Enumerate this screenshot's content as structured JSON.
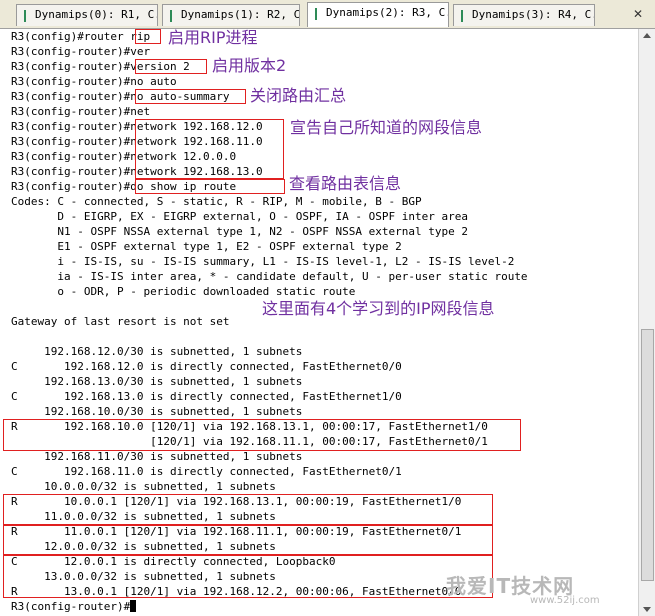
{
  "tabs": [
    {
      "label": "Dynamips(0): R1, C..."
    },
    {
      "label": "Dynamips(1): R2, C..."
    },
    {
      "label": "Dynamips(2): R3, C..."
    },
    {
      "label": "Dynamips(3): R4, C..."
    }
  ],
  "close_glyph": "✕",
  "terminal_lines": [
    "R3(config)#router rip",
    "R3(config-router)#ver",
    "R3(config-router)#version 2",
    "R3(config-router)#no auto",
    "R3(config-router)#no auto-summary",
    "R3(config-router)#net",
    "R3(config-router)#network 192.168.12.0",
    "R3(config-router)#network 192.168.11.0",
    "R3(config-router)#network 12.0.0.0",
    "R3(config-router)#network 192.168.13.0",
    "R3(config-router)#do show ip route",
    "Codes: C - connected, S - static, R - RIP, M - mobile, B - BGP",
    "       D - EIGRP, EX - EIGRP external, O - OSPF, IA - OSPF inter area",
    "       N1 - OSPF NSSA external type 1, N2 - OSPF NSSA external type 2",
    "       E1 - OSPF external type 1, E2 - OSPF external type 2",
    "       i - IS-IS, su - IS-IS summary, L1 - IS-IS level-1, L2 - IS-IS level-2",
    "       ia - IS-IS inter area, * - candidate default, U - per-user static route",
    "       o - ODR, P - periodic downloaded static route",
    "",
    "Gateway of last resort is not set",
    "",
    "     192.168.12.0/30 is subnetted, 1 subnets",
    "C       192.168.12.0 is directly connected, FastEthernet0/0",
    "     192.168.13.0/30 is subnetted, 1 subnets",
    "C       192.168.13.0 is directly connected, FastEthernet1/0",
    "     192.168.10.0/30 is subnetted, 1 subnets",
    "R       192.168.10.0 [120/1] via 192.168.13.1, 00:00:17, FastEthernet1/0",
    "                     [120/1] via 192.168.11.1, 00:00:17, FastEthernet0/1",
    "     192.168.11.0/30 is subnetted, 1 subnets",
    "C       192.168.11.0 is directly connected, FastEthernet0/1",
    "     10.0.0.0/32 is subnetted, 1 subnets",
    "R       10.0.0.1 [120/1] via 192.168.13.1, 00:00:19, FastEthernet1/0",
    "     11.0.0.0/32 is subnetted, 1 subnets",
    "R       11.0.0.1 [120/1] via 192.168.11.1, 00:00:19, FastEthernet0/1",
    "     12.0.0.0/32 is subnetted, 1 subnets",
    "C       12.0.0.1 is directly connected, Loopback0",
    "     13.0.0.0/32 is subnetted, 1 subnets",
    "R       13.0.0.1 [120/1] via 192.168.12.2, 00:00:06, FastEthernet0/0",
    "R3(config-router)#"
  ],
  "annotations": {
    "enable_rip": "启用RIP进程",
    "enable_v2": "启用版本2",
    "disable_summary": "关闭路由汇总",
    "announce_networks": "宣告自己所知道的网段信息",
    "view_routes": "查看路由表信息",
    "learned_routes": "这里面有4个学习到的IP网段信息"
  },
  "watermark": {
    "logo_text": "我爱IT技术网",
    "url": "www.52ij.com"
  },
  "colors": {
    "annotation": "#7030a0",
    "highlight_box": "#e02020",
    "active_tab_marker": "#2e8b57"
  }
}
